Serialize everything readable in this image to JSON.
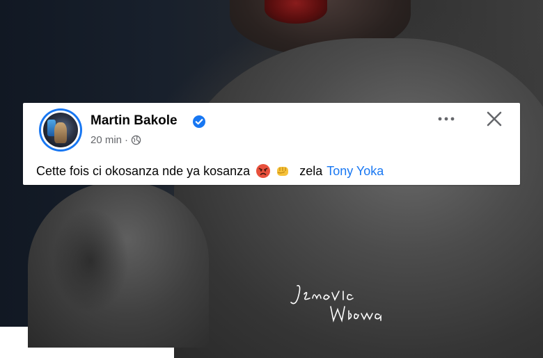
{
  "post": {
    "author": "Martin Bakole",
    "time": "20 min",
    "separator": "·",
    "text": "Cette fois ci okosanza nde ya kosanza",
    "emojis": [
      "angry-face-icon",
      "oncoming-fist-icon"
    ],
    "after_emoji": "zela",
    "tagged": "Tony Yoka"
  },
  "watermark": {
    "text": "Jenovic Mbowa"
  },
  "colors": {
    "accent": "#1877f2",
    "meta": "#65676b",
    "text": "#050505"
  }
}
